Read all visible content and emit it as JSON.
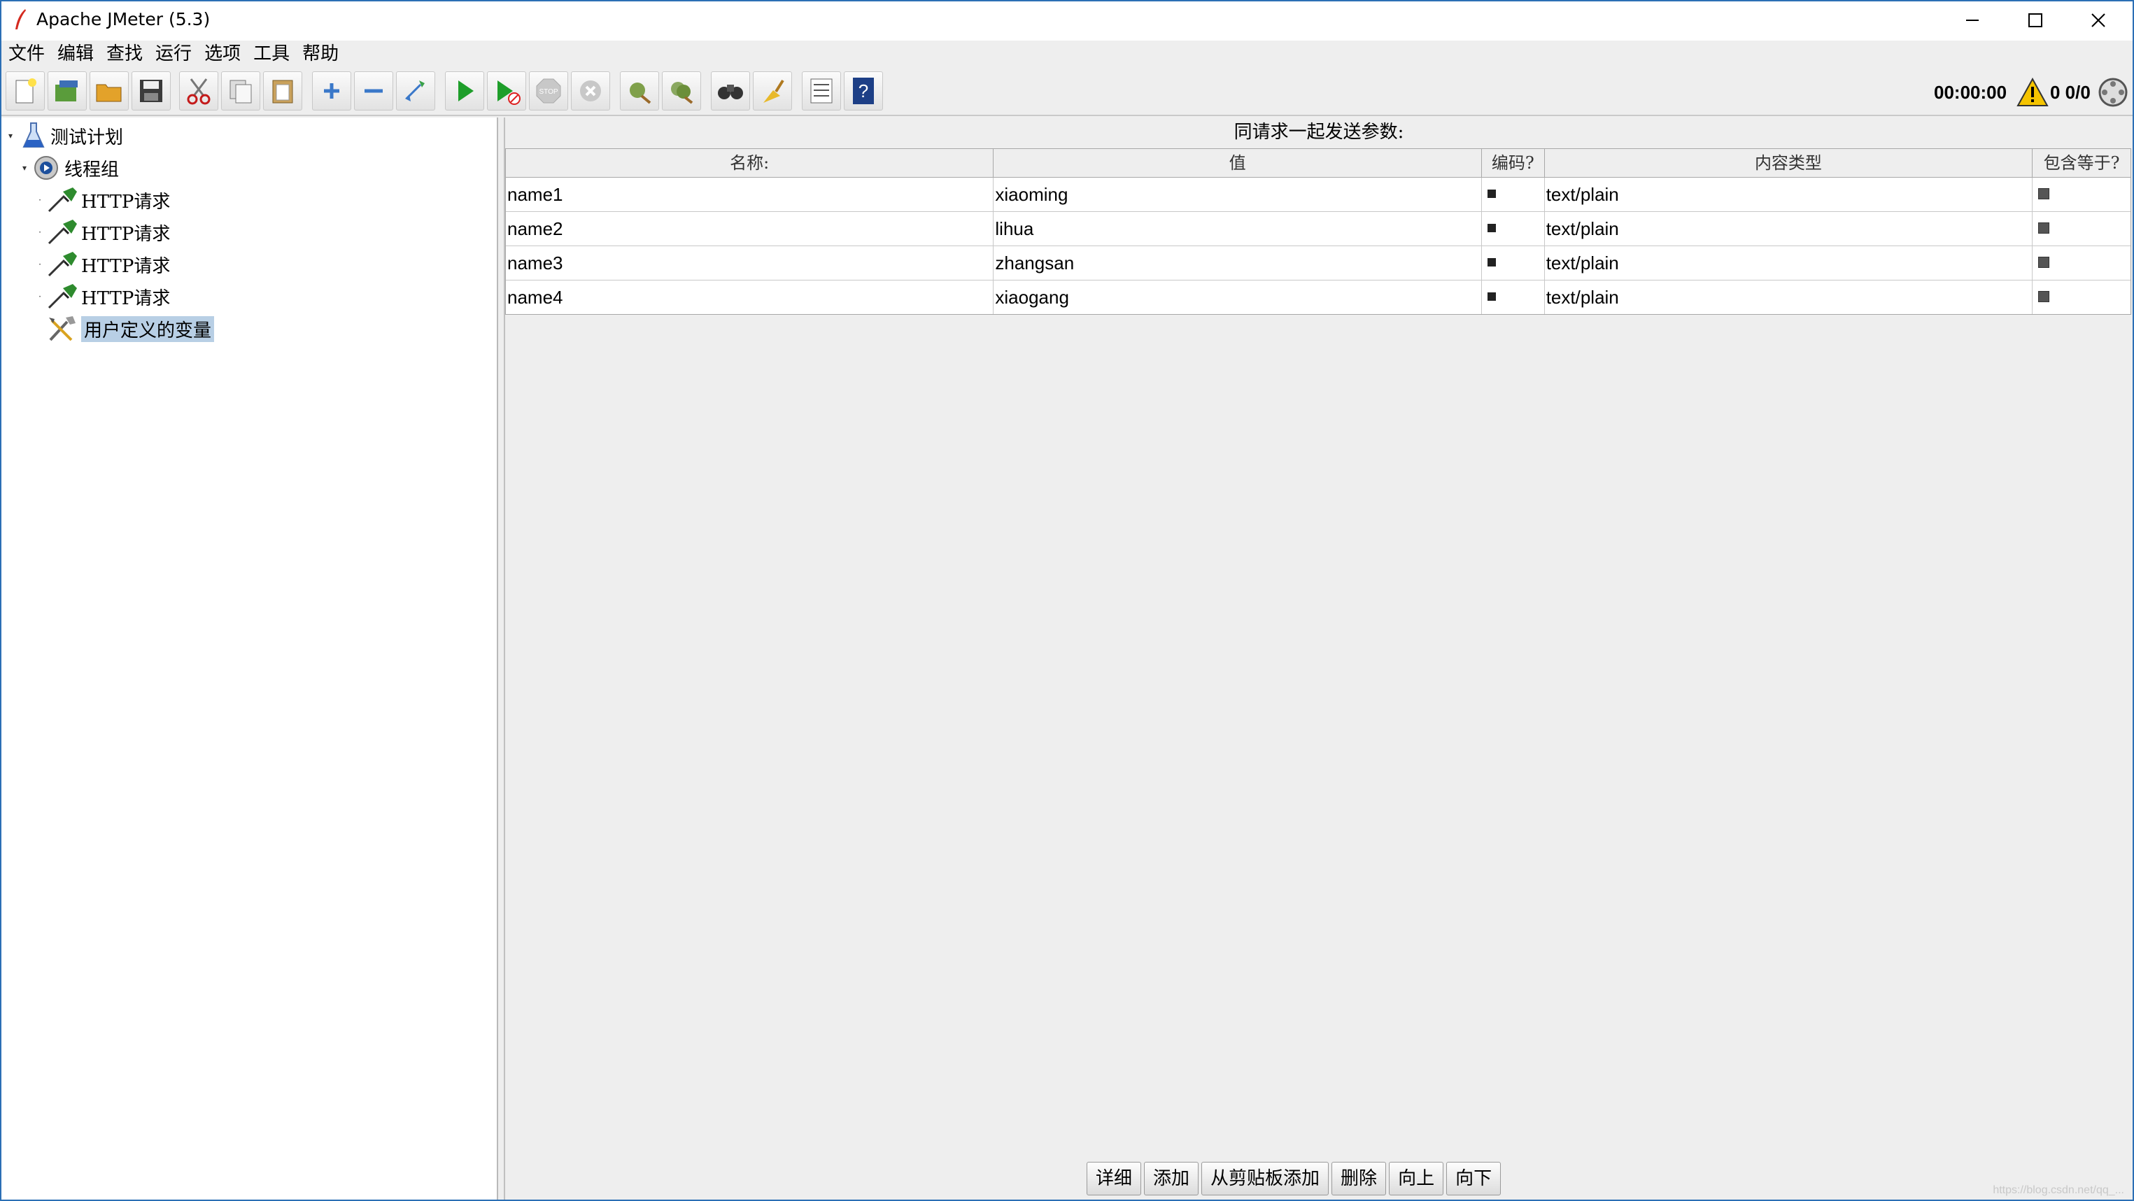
{
  "window": {
    "title": "Apache JMeter (5.3)",
    "controls": [
      "minimize",
      "maximize",
      "close"
    ]
  },
  "menu": [
    "文件",
    "编辑",
    "查找",
    "运行",
    "选项",
    "工具",
    "帮助"
  ],
  "toolbar": {
    "buttons": [
      "new-icon",
      "templates-icon",
      "open-icon",
      "save-icon",
      "cut-icon",
      "copy-icon",
      "paste-icon",
      "expand-icon",
      "collapse-icon",
      "toggle-icon",
      "start-icon",
      "start-no-pause-icon",
      "stop-icon",
      "shutdown-icon",
      "clear-icon",
      "clear-all-icon",
      "search-icon",
      "reset-search-icon",
      "function-helper-icon",
      "help-icon"
    ],
    "timer": "00:00:00",
    "counts": "0 0/0"
  },
  "tree": {
    "items": [
      {
        "label": "测试计划",
        "icon": "test-plan-icon"
      },
      {
        "label": "线程组",
        "icon": "thread-group-icon"
      },
      {
        "label": "HTTP请求",
        "icon": "http-sampler-icon"
      },
      {
        "label": "HTTP请求",
        "icon": "http-sampler-icon"
      },
      {
        "label": "HTTP请求",
        "icon": "http-sampler-icon"
      },
      {
        "label": "HTTP请求",
        "icon": "http-sampler-icon"
      },
      {
        "label": "用户定义的变量",
        "icon": "user-variables-icon",
        "selected": true
      }
    ]
  },
  "panel": {
    "title": "同请求一起发送参数:",
    "columns": [
      "名称:",
      "值",
      "编码?",
      "内容类型",
      "包含等于?"
    ],
    "rows": [
      {
        "name": "name1",
        "value": "xiaoming",
        "content_type": "text/plain"
      },
      {
        "name": "name2",
        "value": "lihua",
        "content_type": "text/plain"
      },
      {
        "name": "name3",
        "value": "zhangsan",
        "content_type": "text/plain"
      },
      {
        "name": "name4",
        "value": "xiaogang",
        "content_type": "text/plain"
      }
    ],
    "buttons": [
      "详细",
      "添加",
      "从剪贴板添加",
      "删除",
      "向上",
      "向下"
    ]
  },
  "watermark": "https://blog.csdn.net/qq_..."
}
